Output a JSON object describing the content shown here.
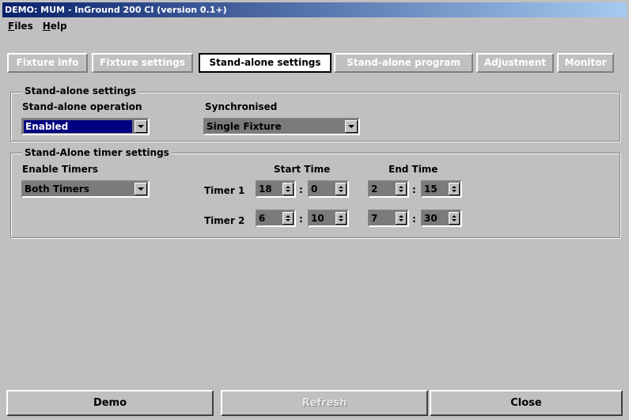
{
  "window": {
    "title": "DEMO: MUM - InGround 200 CI (version 0.1+)"
  },
  "menu": [
    "Files",
    "Help"
  ],
  "tabs": [
    {
      "label": "Fixture info",
      "state": "disabled"
    },
    {
      "label": "Fixture settings",
      "state": "disabled"
    },
    {
      "label": "Stand-alone settings",
      "state": "active"
    },
    {
      "label": "Stand-alone program",
      "state": "disabled"
    },
    {
      "label": "Adjustment",
      "state": "disabled"
    },
    {
      "label": "Monitor",
      "state": "disabled"
    }
  ],
  "standalone": {
    "group_title": "Stand-alone settings",
    "operation_label": "Stand-alone operation",
    "operation_value": "Enabled",
    "sync_label": "Synchronised",
    "sync_value": "Single Fixture"
  },
  "timers": {
    "group_title": "Stand-Alone timer settings",
    "enable_label": "Enable Timers",
    "enable_value": "Both Timers",
    "start_header": "Start Time",
    "end_header": "End Time",
    "colon": ":",
    "rows": [
      {
        "label": "Timer 1",
        "start_h": "18",
        "start_m": "0",
        "end_h": "2",
        "end_m": "15"
      },
      {
        "label": "Timer 2",
        "start_h": "6",
        "start_m": "10",
        "end_h": "7",
        "end_m": "30"
      }
    ]
  },
  "buttons": {
    "demo": "Demo",
    "refresh": "Refresh",
    "close": "Close"
  },
  "colors": {
    "titlebar_start": "#08216b",
    "titlebar_end": "#a6caf0",
    "selection": "#000080",
    "face": "#c0c0c0"
  }
}
